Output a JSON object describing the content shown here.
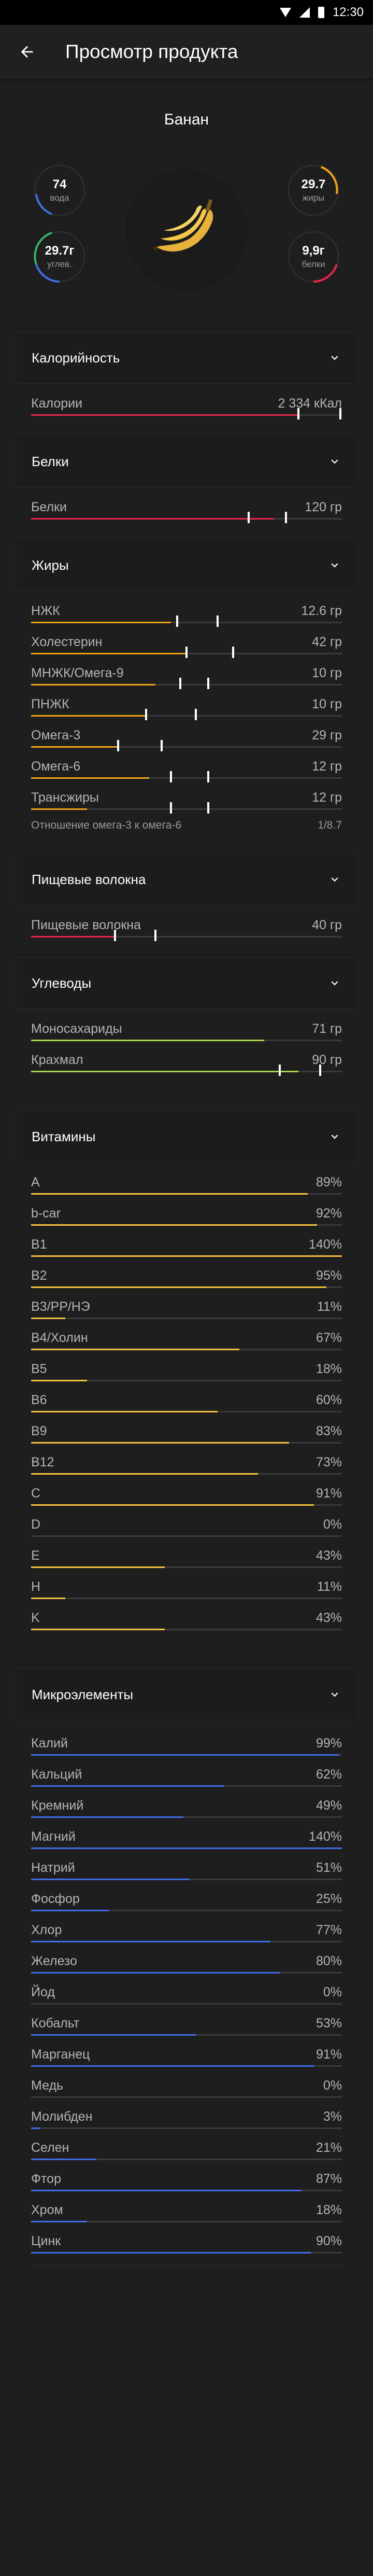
{
  "status_bar": {
    "time": "12:30"
  },
  "app_bar": {
    "title": "Просмотр продукта"
  },
  "product": {
    "name": "Банан"
  },
  "colors": {
    "red": "#e8264a",
    "orange": "#f2a21b",
    "yellow": "#f6c23e",
    "green": "#a9d64e",
    "blue": "#3f6ee8",
    "gauge_green": "#35b36a",
    "gauge_blue": "#3d6fe0"
  },
  "gauges": {
    "water": {
      "value": "74",
      "label": "вода"
    },
    "fat": {
      "value": "29.7",
      "label": "жиры"
    },
    "carbs": {
      "value": "29.7г",
      "label": "углев."
    },
    "protein": {
      "value": "9,9г",
      "label": "белки"
    }
  },
  "sections": [
    {
      "title": "Калорийность",
      "accent": "red",
      "rows": [
        {
          "label": "Калории",
          "value": "2 334 кКал",
          "fill": 0.86,
          "ticks": [
            0.86,
            0.995
          ]
        }
      ]
    },
    {
      "title": "Белки",
      "accent": "red",
      "rows": [
        {
          "label": "Белки",
          "value": "120 гр",
          "fill": 0.78,
          "ticks": [
            0.7,
            0.82
          ]
        }
      ]
    },
    {
      "title": "Жиры",
      "accent": "orange",
      "rows": [
        {
          "label": "НЖК",
          "value": "12.6 гр",
          "fill": 0.45,
          "ticks": [
            0.47,
            0.6
          ]
        },
        {
          "label": "Холестерин",
          "value": "42 гр",
          "fill": 0.5,
          "ticks": [
            0.5,
            0.65
          ]
        },
        {
          "label": "МНЖК/Омега-9",
          "value": "10 гр",
          "fill": 0.4,
          "ticks": [
            0.48,
            0.57
          ]
        },
        {
          "label": "ПНЖК",
          "value": "10 гр",
          "fill": 0.37,
          "ticks": [
            0.37,
            0.53
          ]
        },
        {
          "label": "Омега-3",
          "value": "29 гр",
          "fill": 0.28,
          "ticks": [
            0.28,
            0.42
          ]
        },
        {
          "label": "Омега-6",
          "value": "12 гр",
          "fill": 0.38,
          "ticks": [
            0.45,
            0.57
          ]
        },
        {
          "label": "Трансжиры",
          "value": "12 гр",
          "fill": 0.18,
          "ticks": [
            0.45,
            0.57
          ]
        }
      ],
      "note": {
        "label": "Отношение омега-3 к омега-6",
        "value": "1/8.7"
      }
    },
    {
      "title": "Пищевые волокна",
      "accent": "red",
      "rows": [
        {
          "label": "Пищевые волокна",
          "value": "40 гр",
          "fill": 0.27,
          "ticks": [
            0.27,
            0.4
          ]
        }
      ]
    },
    {
      "title": "Углеводы",
      "accent": "green",
      "rows": [
        {
          "label": "Моносахариды",
          "value": "71 гр",
          "fill": 0.75,
          "ticks": []
        },
        {
          "label": "Крахмал",
          "value": "90 гр",
          "fill": 0.86,
          "ticks": [
            0.8,
            0.93
          ]
        }
      ]
    },
    {
      "title": "Витамины",
      "accent": "yellow",
      "rows": [
        {
          "label": "A",
          "value": "89%",
          "fill": 0.89,
          "ticks": []
        },
        {
          "label": "b-car",
          "value": "92%",
          "fill": 0.92,
          "ticks": []
        },
        {
          "label": "B1",
          "value": "140%",
          "fill": 1.0,
          "ticks": []
        },
        {
          "label": "B2",
          "value": "95%",
          "fill": 0.95,
          "ticks": []
        },
        {
          "label": "B3/PP/НЭ",
          "value": "11%",
          "fill": 0.11,
          "ticks": []
        },
        {
          "label": "B4/Холин",
          "value": "67%",
          "fill": 0.67,
          "ticks": []
        },
        {
          "label": "B5",
          "value": "18%",
          "fill": 0.18,
          "ticks": []
        },
        {
          "label": "B6",
          "value": "60%",
          "fill": 0.6,
          "ticks": []
        },
        {
          "label": "B9",
          "value": "83%",
          "fill": 0.83,
          "ticks": []
        },
        {
          "label": "B12",
          "value": "73%",
          "fill": 0.73,
          "ticks": []
        },
        {
          "label": "C",
          "value": "91%",
          "fill": 0.91,
          "ticks": []
        },
        {
          "label": "D",
          "value": "0%",
          "fill": 0.0,
          "ticks": []
        },
        {
          "label": "E",
          "value": "43%",
          "fill": 0.43,
          "ticks": []
        },
        {
          "label": "H",
          "value": "11%",
          "fill": 0.11,
          "ticks": []
        },
        {
          "label": "K",
          "value": "43%",
          "fill": 0.43,
          "ticks": []
        }
      ]
    },
    {
      "title": "Микроэлементы",
      "accent": "blue",
      "rows": [
        {
          "label": "Калий",
          "value": "99%",
          "fill": 0.99,
          "ticks": []
        },
        {
          "label": "Кальций",
          "value": "62%",
          "fill": 0.62,
          "ticks": []
        },
        {
          "label": "Кремний",
          "value": "49%",
          "fill": 0.49,
          "ticks": []
        },
        {
          "label": "Магний",
          "value": "140%",
          "fill": 1.0,
          "ticks": []
        },
        {
          "label": "Натрий",
          "value": "51%",
          "fill": 0.51,
          "ticks": []
        },
        {
          "label": "Фосфор",
          "value": "25%",
          "fill": 0.25,
          "ticks": []
        },
        {
          "label": "Хлор",
          "value": "77%",
          "fill": 0.77,
          "ticks": []
        },
        {
          "label": "Железо",
          "value": "80%",
          "fill": 0.8,
          "ticks": []
        },
        {
          "label": "Йод",
          "value": "0%",
          "fill": 0.0,
          "ticks": []
        },
        {
          "label": "Кобальт",
          "value": "53%",
          "fill": 0.53,
          "ticks": []
        },
        {
          "label": "Марганец",
          "value": "91%",
          "fill": 0.91,
          "ticks": []
        },
        {
          "label": "Медь",
          "value": "0%",
          "fill": 0.0,
          "ticks": []
        },
        {
          "label": "Молибден",
          "value": "3%",
          "fill": 0.03,
          "ticks": []
        },
        {
          "label": "Селен",
          "value": "21%",
          "fill": 0.21,
          "ticks": []
        },
        {
          "label": "Фтор",
          "value": "87%",
          "fill": 0.87,
          "ticks": []
        },
        {
          "label": "Хром",
          "value": "18%",
          "fill": 0.18,
          "ticks": []
        },
        {
          "label": "Цинк",
          "value": "90%",
          "fill": 0.9,
          "ticks": []
        }
      ]
    }
  ]
}
